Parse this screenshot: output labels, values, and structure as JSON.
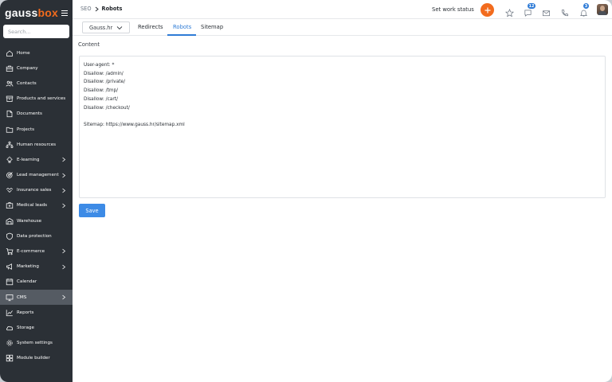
{
  "app": {
    "logo_main": "gauss",
    "logo_accent": "box"
  },
  "sidebar": {
    "search_placeholder": "Search...",
    "items": [
      {
        "label": "Home",
        "icon": "home-icon",
        "chevron": false
      },
      {
        "label": "Company",
        "icon": "briefcase-icon",
        "chevron": false
      },
      {
        "label": "Contacts",
        "icon": "people-icon",
        "chevron": false
      },
      {
        "label": "Products and services",
        "icon": "box-icon",
        "chevron": false
      },
      {
        "label": "Documents",
        "icon": "document-icon",
        "chevron": false
      },
      {
        "label": "Projects",
        "icon": "folder-icon",
        "chevron": false
      },
      {
        "label": "Human resources",
        "icon": "org-chart-icon",
        "chevron": false
      },
      {
        "label": "E-learning",
        "icon": "lightbulb-icon",
        "chevron": true
      },
      {
        "label": "Lead management",
        "icon": "target-icon",
        "chevron": true
      },
      {
        "label": "Insurance sales",
        "icon": "handshake-icon",
        "chevron": true
      },
      {
        "label": "Medical leads",
        "icon": "medical-case-icon",
        "chevron": true
      },
      {
        "label": "Warehouse",
        "icon": "warehouse-icon",
        "chevron": false
      },
      {
        "label": "Data protection",
        "icon": "shield-icon",
        "chevron": false
      },
      {
        "label": "E-commerce",
        "icon": "cart-icon",
        "chevron": true
      },
      {
        "label": "Marketing",
        "icon": "megaphone-icon",
        "chevron": true
      },
      {
        "label": "Calendar",
        "icon": "calendar-icon",
        "chevron": false
      },
      {
        "label": "CMS",
        "icon": "monitor-icon",
        "chevron": true,
        "active": true
      },
      {
        "label": "Reports",
        "icon": "chart-line-icon",
        "chevron": false
      },
      {
        "label": "Storage",
        "icon": "cloud-icon",
        "chevron": false
      },
      {
        "label": "System settings",
        "icon": "gear-icon",
        "chevron": false
      },
      {
        "label": "Module builder",
        "icon": "module-icon",
        "chevron": false
      }
    ]
  },
  "header": {
    "breadcrumb_parent": "SEO",
    "breadcrumb_current": "Robots",
    "work_status": "Set work status",
    "messages_badge": "12",
    "notifications_badge": "3"
  },
  "tabs": {
    "site_select": "Gauss.hr",
    "items": [
      "Redirects",
      "Robots",
      "Sitemap"
    ],
    "active": "Robots"
  },
  "main": {
    "content_label": "Content",
    "robots_text": "User-agent: *\nDisallow: /admin/\nDisallow: /private/\nDisallow: /tmp/\nDisallow: /cart/\nDisallow: /checkout/\n\nSitemap: https://www.gauss.hr/sitemap.xml",
    "save_label": "Save"
  },
  "colors": {
    "sidebar_bg": "#2b3036",
    "sidebar_active": "#555b63",
    "accent_orange": "#f26b1d",
    "accent_blue": "#2e7bd6",
    "save_button": "#3d8be6"
  }
}
